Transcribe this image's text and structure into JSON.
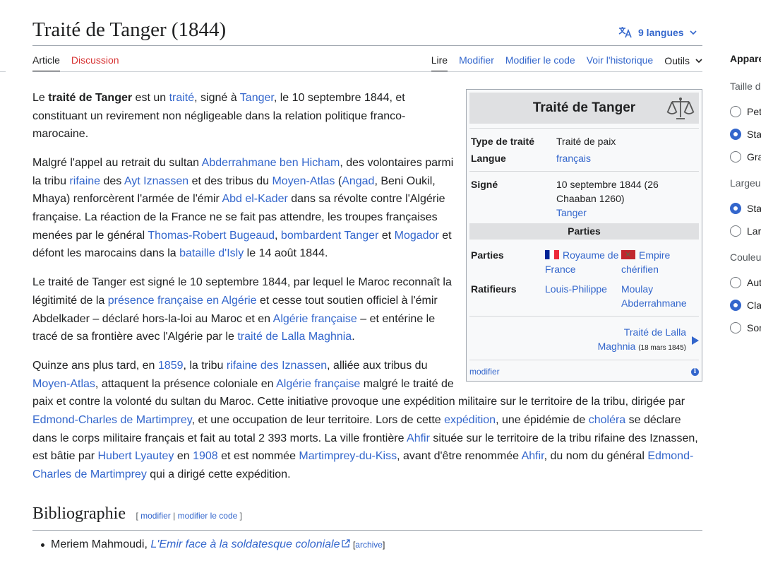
{
  "header": {
    "title": "Traité de Tanger (1844)",
    "languages": "9 langues"
  },
  "tabs": {
    "article": "Article",
    "discussion": "Discussion",
    "read": "Lire",
    "edit": "Modifier",
    "edit_source": "Modifier le code",
    "history": "Voir l'historique",
    "tools": "Outils"
  },
  "infobox": {
    "title": "Traité de Tanger",
    "type_label": "Type de traité",
    "type_value": "Traité de paix",
    "langue_label": "Langue",
    "langue_value": "français",
    "signe_label": "Signé",
    "signe_value": "10 septembre 1844 (26 Chaaban 1260)",
    "signe_place": "Tanger",
    "parties_section": "Parties",
    "parties_label": "Parties",
    "party1": "Royaume de France",
    "party2": "Empire chérifien",
    "ratif_label": "Ratifieurs",
    "ratif1": "Louis-Philippe",
    "ratif2": "Moulay Abderrahmane",
    "next_link": "Traité de Lalla Maghnia",
    "next_date": "(18 mars 1845)",
    "edit_link": "modifier"
  },
  "bibliography": {
    "heading": "Bibliographie",
    "edit_link": "modifier",
    "edit_source_link": "modifier le code",
    "item_author": "Meriem Mahmoudi,",
    "item_title": "L'Emir face à la soldatesque coloniale",
    "item_archive": "archive"
  },
  "appearance": {
    "title": "Apparence",
    "size_group": "Taille du texte",
    "size_opts": [
      "Petite",
      "Standard",
      "Grande"
    ],
    "width_group": "Largeur",
    "width_opts": [
      "Standard",
      "Large"
    ],
    "color_group": "Couleur",
    "color_opts": [
      "Automatique",
      "Clair",
      "Sombre"
    ]
  }
}
